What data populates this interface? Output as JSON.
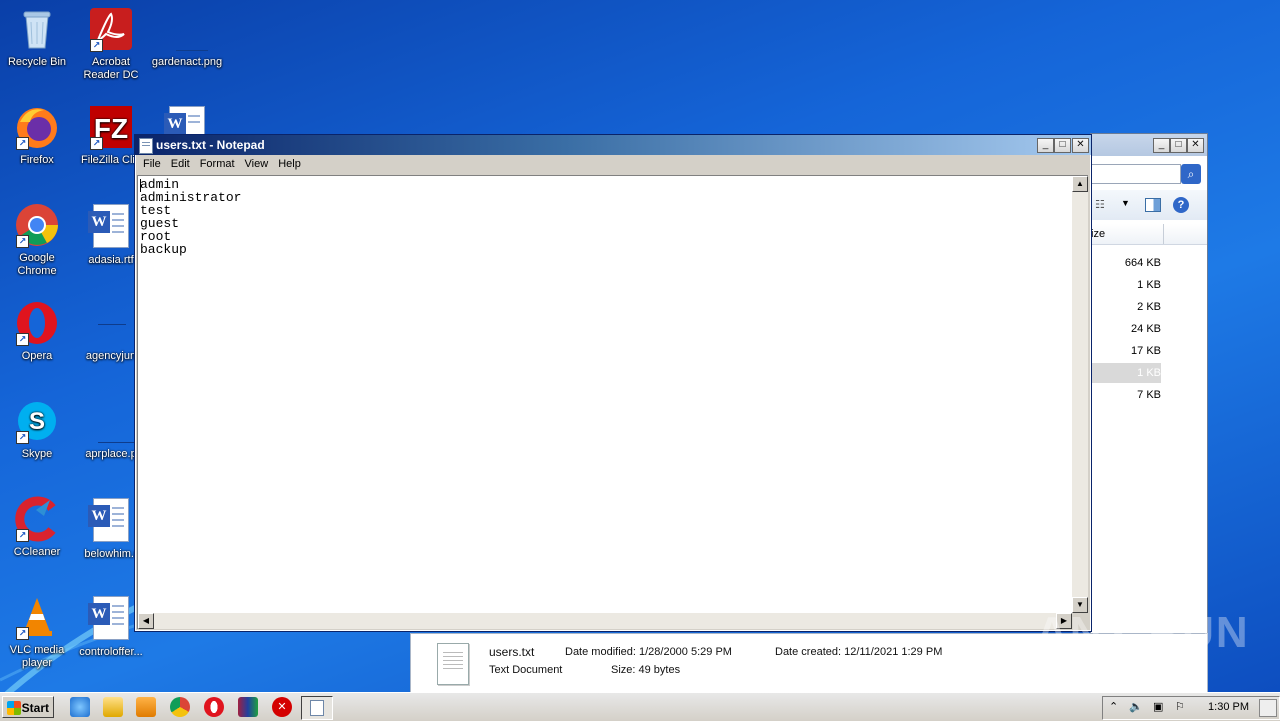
{
  "desktop": {
    "icons": [
      {
        "label": "Recycle Bin"
      },
      {
        "label": "Acrobat Reader DC"
      },
      {
        "label": "gardenact.png"
      },
      {
        "label": "Firefox"
      },
      {
        "label": "FileZilla Clie"
      },
      {
        "label": "Google Chrome"
      },
      {
        "label": "adasia.rtf"
      },
      {
        "label": "Opera"
      },
      {
        "label": "agencyjun"
      },
      {
        "label": "Skype"
      },
      {
        "label": "aprplace.p"
      },
      {
        "label": "CCleaner"
      },
      {
        "label": "belowhim.r"
      },
      {
        "label": "VLC media player"
      },
      {
        "label": "controloffer..."
      }
    ]
  },
  "notepad": {
    "title": "users.txt - Notepad",
    "menu": [
      "File",
      "Edit",
      "Format",
      "View",
      "Help"
    ],
    "content": "admin\nadministrator\ntest\nguest\nroot\nbackup",
    "controls": {
      "minimize": "_",
      "maximize": "□",
      "close": "✕"
    }
  },
  "explorer": {
    "column_header": "ize",
    "sizes": [
      "664 KB",
      "1 KB",
      "2 KB",
      "24 KB",
      "17 KB",
      "1 KB",
      "7 KB"
    ],
    "selected_index": 5,
    "details": {
      "name": "users.txt",
      "type": "Text Document",
      "date_modified": "Date modified: 1/28/2000 5:29 PM",
      "size": "Size: 49 bytes",
      "date_created": "Date created: 12/11/2021 1:29 PM"
    }
  },
  "taskbar": {
    "start_label": "Start",
    "clock": "1:30 PM"
  },
  "watermark": "ANY RUN",
  "colors": {
    "desktop": "#1565d8",
    "title_active": "#0a246a"
  }
}
